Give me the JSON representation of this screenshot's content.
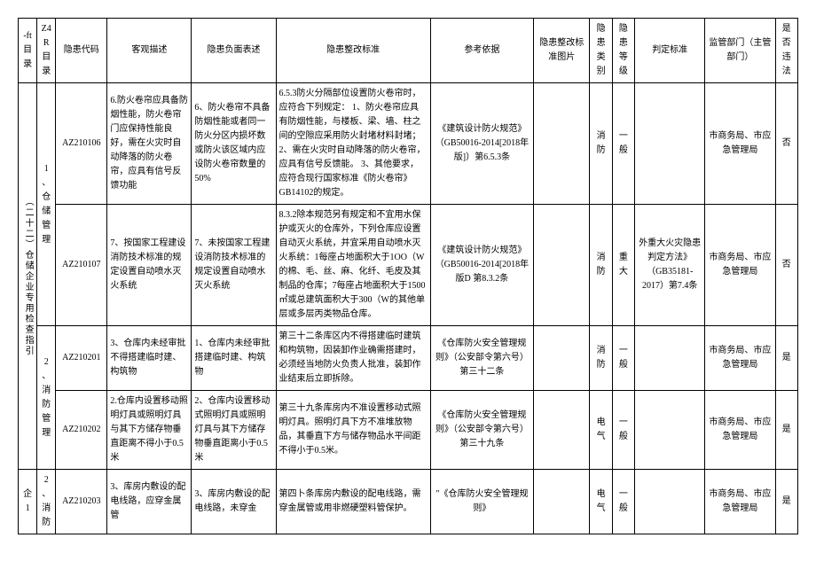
{
  "headers": {
    "c0": "-ft 目录",
    "c1": "Z4R 目录",
    "c2": "隐患代码",
    "c3": "客观描述",
    "c4": "隐患负面表述",
    "c5": "隐患整改标准",
    "c6": "参考依据",
    "c7": "隐患整改标准图片",
    "c8": "隐患类别",
    "c9": "隐患等级",
    "c10": "判定标准",
    "c11": "监管部门（主管部门）",
    "c12": "是否违法"
  },
  "left_label": "（二十二）仓储企业专用检查指引",
  "sections": {
    "s1": "1、仓储管理",
    "s2": "2、消防管理",
    "s3": "企1",
    "s4": "2、消防"
  },
  "rows": [
    {
      "code": "AZ210106",
      "desc": "6.防火卷帘应具备防烟性能，防火卷帘门应保持性能良好，需在火灾时自动降落的防火卷帘，应具有信号反馈功能",
      "neg": "6、防火卷帘不具备防烟性能或者同一防火分区内损坏数或防火该区域内应设防火卷帘数量的50%",
      "std": "6.5.3防火分隔部位设置防火卷帘时，应符合下列规定：\n1、防火卷帘应具有防烟性能，与楼板、梁、墙、柱之间的空隙应采用防火封堵材料封堵；\n2、需在火灾时自动降落的防火卷帘，应具有信号反馈能。\n3、其他要求，应符合现行国家标准《防火卷帘》GB14102的规定。",
      "ref": "《建筑设计防火规范》（GB50016-2014[2018年版]）第6.5.3条",
      "cat": "消防",
      "lvl": "一般",
      "judge": "",
      "dept": "市商务局、市应急管理局",
      "law": "否"
    },
    {
      "code": "AZ210107",
      "desc": "7、按国家工程建设消防技术标准的规定设置自动喷水灭火系统",
      "neg": "7、未按国家工程建设消防技术标准的规定设置自动喷水灭火系统",
      "std": "8.3.2除本规范另有规定和不宜用水保护或灭火的仓库外，下列仓库应设置自动灭火系统，并宜采用自动喷水灭火系统：1每座占地面积大于1OO（W的棉、毛、丝、麻、化纤、毛皮及其制品的仓库；7每座占地面积大于1500㎡或总建筑面积大于300（W的其他单层或多层丙类物品仓库。",
      "ref": "《建筑设计防火规范》（GB50016-2014[2018年版D 第8.3.2条",
      "cat": "消防",
      "lvl": "重大",
      "judge": "外重大火灾隐患判定方法》（GB35181-2017）第7.4条",
      "dept": "市商务局、市应急管理局",
      "law": "否"
    },
    {
      "code": "AZ210201",
      "desc": "3、仓库内未经审批不得搭建临时建、构筑物",
      "neg": "1、仓库内未经审批搭建临时建、构筑物",
      "std": "第三十二条库区内不得搭建临时建筑和构筑物，因装卸作业确需搭建时，必须经当地防火负责人批准，装卸作业结束后立即拆除。",
      "ref": "《仓库防火安全管理规则》（公安部令第六号）第三十二条",
      "cat": "消防",
      "lvl": "一般",
      "judge": "",
      "dept": "市商务局、市应急管理局",
      "law": "是"
    },
    {
      "code": "AZ210202",
      "desc": "2.仓库内设置移动照明灯具或照明灯具与其下方储存物垂直距离不得小于0.5米",
      "neg": "2、仓库内设置移动式照明灯具或照明灯具与其下方储存物垂直距离小于0.5米",
      "std": "第三十九条库房内不准设置移动式照明灯具。照明灯具下方不准堆放物品，其垂直下方与储存物品水平间距不得小于0.5米。",
      "ref": "《仓库防火安全管理规则》（公安部令第六号）第三十九条",
      "cat": "电气",
      "lvl": "一般",
      "judge": "",
      "dept": "市商务局、市应急管理局",
      "law": "是"
    },
    {
      "code": "AZ210203",
      "desc": "3、库房内敷设的配电线路，应穿金属管",
      "neg": "3、库房内敷设的配电线路，未穿金",
      "std": "第四卜条库房内敷设的配电线路，需穿金属管或用非燃硬塑料管保护。",
      "ref": "\"《仓库防火安全管理规则》",
      "cat": "电气",
      "lvl": "一般",
      "judge": "",
      "dept": "市商务局、市应急管理局",
      "law": "是"
    }
  ]
}
